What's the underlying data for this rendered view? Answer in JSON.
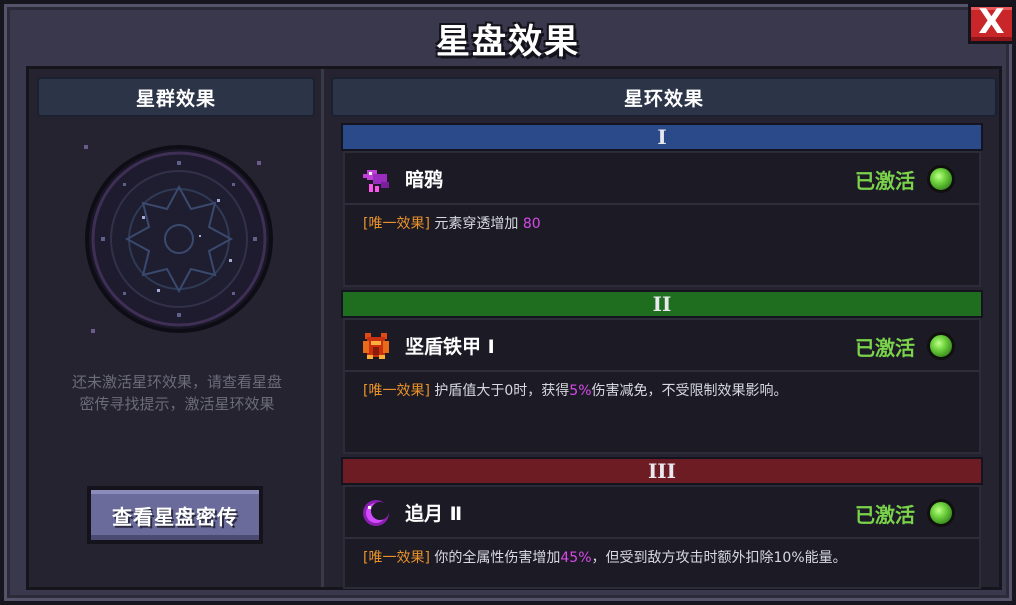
{
  "window": {
    "title": "星盘效果",
    "close_label": "X"
  },
  "left": {
    "header": "星群效果",
    "hint_line1": "还未激活星环效果，请查看星盘",
    "hint_line2": "密传寻找提示，激活星环效果",
    "button_label": "查看星盘密传"
  },
  "right": {
    "header": "星环效果",
    "rings": [
      {
        "numeral": "I",
        "color": "#2b4a8a",
        "name": "暗鸦",
        "status": "已激活",
        "icon": "raven-icon",
        "tag": "[唯一效果]",
        "desc_before": " 元素穿透增加 ",
        "desc_value": "80",
        "desc_after": ""
      },
      {
        "numeral": "II",
        "color": "#1f6e1f",
        "name": "坚盾铁甲 Ⅰ",
        "status": "已激活",
        "icon": "iron-armor-icon",
        "tag": "[唯一效果]",
        "desc_before": " 护盾值大于0时，获得",
        "desc_value": "5%",
        "desc_after": "伤害减免，不受限制效果影响。"
      },
      {
        "numeral": "III",
        "color": "#6e1c24",
        "name": "追月 Ⅱ",
        "status": "已激活",
        "icon": "crescent-moon-icon",
        "tag": "[唯一效果]",
        "desc_before": " 你的全属性伤害增加",
        "desc_value": "45%",
        "desc_after": "，但受到敌方攻击时额外扣除10%能量。"
      }
    ]
  },
  "colors": {
    "status_green": "#7ad34a",
    "tag_orange": "#e8912a",
    "highlight_purple": "#d64ae8"
  }
}
